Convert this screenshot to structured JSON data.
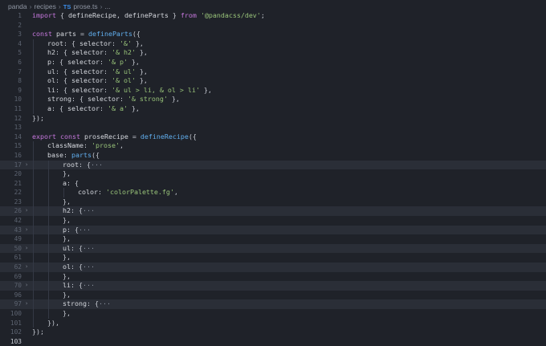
{
  "breadcrumb": {
    "items": [
      "panda",
      "recipes",
      "prose.ts",
      "..."
    ],
    "file_icon": "TS"
  },
  "lines": [
    {
      "n": "1",
      "fold": false,
      "indent": 0,
      "tokens": [
        [
          "k",
          "import"
        ],
        [
          "pl",
          " { "
        ],
        [
          "pr",
          "defineRecipe"
        ],
        [
          "pl",
          ", "
        ],
        [
          "pr",
          "defineParts"
        ],
        [
          "pl",
          " } "
        ],
        [
          "k",
          "from"
        ],
        [
          "pl",
          " "
        ],
        [
          "s",
          "'@pandacss/dev'"
        ],
        [
          "pl",
          ";"
        ]
      ]
    },
    {
      "n": "2",
      "fold": false,
      "indent": 0,
      "tokens": []
    },
    {
      "n": "3",
      "fold": false,
      "indent": 0,
      "tokens": [
        [
          "k",
          "const"
        ],
        [
          "pl",
          " "
        ],
        [
          "pr",
          "parts"
        ],
        [
          "pl",
          " = "
        ],
        [
          "f",
          "defineParts"
        ],
        [
          "pl",
          "({"
        ]
      ]
    },
    {
      "n": "4",
      "fold": false,
      "indent": 1,
      "tokens": [
        [
          "pr",
          "root"
        ],
        [
          "pl",
          ": { "
        ],
        [
          "pr",
          "selector"
        ],
        [
          "pl",
          ": "
        ],
        [
          "s",
          "'&'"
        ],
        [
          "pl",
          " },"
        ]
      ]
    },
    {
      "n": "5",
      "fold": false,
      "indent": 1,
      "tokens": [
        [
          "pr",
          "h2"
        ],
        [
          "pl",
          ": { "
        ],
        [
          "pr",
          "selector"
        ],
        [
          "pl",
          ": "
        ],
        [
          "s",
          "'& h2'"
        ],
        [
          "pl",
          " },"
        ]
      ]
    },
    {
      "n": "6",
      "fold": false,
      "indent": 1,
      "tokens": [
        [
          "pr",
          "p"
        ],
        [
          "pl",
          ": { "
        ],
        [
          "pr",
          "selector"
        ],
        [
          "pl",
          ": "
        ],
        [
          "s",
          "'& p'"
        ],
        [
          "pl",
          " },"
        ]
      ]
    },
    {
      "n": "7",
      "fold": false,
      "indent": 1,
      "tokens": [
        [
          "pr",
          "ul"
        ],
        [
          "pl",
          ": { "
        ],
        [
          "pr",
          "selector"
        ],
        [
          "pl",
          ": "
        ],
        [
          "s",
          "'& ul'"
        ],
        [
          "pl",
          " },"
        ]
      ]
    },
    {
      "n": "8",
      "fold": false,
      "indent": 1,
      "tokens": [
        [
          "pr",
          "ol"
        ],
        [
          "pl",
          ": { "
        ],
        [
          "pr",
          "selector"
        ],
        [
          "pl",
          ": "
        ],
        [
          "s",
          "'& ol'"
        ],
        [
          "pl",
          " },"
        ]
      ]
    },
    {
      "n": "9",
      "fold": false,
      "indent": 1,
      "tokens": [
        [
          "pr",
          "li"
        ],
        [
          "pl",
          ": { "
        ],
        [
          "pr",
          "selector"
        ],
        [
          "pl",
          ": "
        ],
        [
          "s",
          "'& ul > li, & ol > li'"
        ],
        [
          "pl",
          " },"
        ]
      ]
    },
    {
      "n": "10",
      "fold": false,
      "indent": 1,
      "tokens": [
        [
          "pr",
          "strong"
        ],
        [
          "pl",
          ": { "
        ],
        [
          "pr",
          "selector"
        ],
        [
          "pl",
          ": "
        ],
        [
          "s",
          "'& strong'"
        ],
        [
          "pl",
          " },"
        ]
      ]
    },
    {
      "n": "11",
      "fold": false,
      "indent": 1,
      "tokens": [
        [
          "pr",
          "a"
        ],
        [
          "pl",
          ": { "
        ],
        [
          "pr",
          "selector"
        ],
        [
          "pl",
          ": "
        ],
        [
          "s",
          "'& a'"
        ],
        [
          "pl",
          " },"
        ]
      ]
    },
    {
      "n": "12",
      "fold": false,
      "indent": 0,
      "tokens": [
        [
          "pl",
          "});"
        ]
      ]
    },
    {
      "n": "13",
      "fold": false,
      "indent": 0,
      "tokens": []
    },
    {
      "n": "14",
      "fold": false,
      "indent": 0,
      "tokens": [
        [
          "k",
          "export"
        ],
        [
          "pl",
          " "
        ],
        [
          "k",
          "const"
        ],
        [
          "pl",
          " "
        ],
        [
          "pr",
          "proseRecipe"
        ],
        [
          "pl",
          " = "
        ],
        [
          "f",
          "defineRecipe"
        ],
        [
          "pl",
          "({"
        ]
      ]
    },
    {
      "n": "15",
      "fold": false,
      "indent": 1,
      "tokens": [
        [
          "pr",
          "className"
        ],
        [
          "pl",
          ": "
        ],
        [
          "s",
          "'prose'"
        ],
        [
          "pl",
          ","
        ]
      ]
    },
    {
      "n": "16",
      "fold": false,
      "indent": 1,
      "tokens": [
        [
          "pr",
          "base"
        ],
        [
          "pl",
          ": "
        ],
        [
          "f",
          "parts"
        ],
        [
          "pl",
          "({"
        ]
      ]
    },
    {
      "n": "17",
      "fold": true,
      "indent": 2,
      "tokens": [
        [
          "pr",
          "root"
        ],
        [
          "pl",
          ": {"
        ],
        [
          "el",
          "···"
        ]
      ]
    },
    {
      "n": "20",
      "fold": false,
      "indent": 2,
      "tokens": [
        [
          "pl",
          "},"
        ]
      ]
    },
    {
      "n": "21",
      "fold": false,
      "indent": 2,
      "tokens": [
        [
          "pr",
          "a"
        ],
        [
          "pl",
          ": {"
        ]
      ]
    },
    {
      "n": "22",
      "fold": false,
      "indent": 3,
      "tokens": [
        [
          "pr",
          "color"
        ],
        [
          "pl",
          ": "
        ],
        [
          "s",
          "'colorPalette.fg'"
        ],
        [
          "pl",
          ","
        ]
      ]
    },
    {
      "n": "23",
      "fold": false,
      "indent": 2,
      "tokens": [
        [
          "pl",
          "},"
        ]
      ]
    },
    {
      "n": "26",
      "fold": true,
      "indent": 2,
      "tokens": [
        [
          "pr",
          "h2"
        ],
        [
          "pl",
          ": {"
        ],
        [
          "el",
          "···"
        ]
      ]
    },
    {
      "n": "42",
      "fold": false,
      "indent": 2,
      "tokens": [
        [
          "pl",
          "},"
        ]
      ]
    },
    {
      "n": "43",
      "fold": true,
      "indent": 2,
      "tokens": [
        [
          "pr",
          "p"
        ],
        [
          "pl",
          ": {"
        ],
        [
          "el",
          "···"
        ]
      ]
    },
    {
      "n": "49",
      "fold": false,
      "indent": 2,
      "tokens": [
        [
          "pl",
          "},"
        ]
      ]
    },
    {
      "n": "50",
      "fold": true,
      "indent": 2,
      "tokens": [
        [
          "pr",
          "ul"
        ],
        [
          "pl",
          ": {"
        ],
        [
          "el",
          "···"
        ]
      ]
    },
    {
      "n": "61",
      "fold": false,
      "indent": 2,
      "tokens": [
        [
          "pl",
          "},"
        ]
      ]
    },
    {
      "n": "62",
      "fold": true,
      "indent": 2,
      "tokens": [
        [
          "pr",
          "ol"
        ],
        [
          "pl",
          ": {"
        ],
        [
          "el",
          "···"
        ]
      ]
    },
    {
      "n": "69",
      "fold": false,
      "indent": 2,
      "tokens": [
        [
          "pl",
          "},"
        ]
      ]
    },
    {
      "n": "70",
      "fold": true,
      "indent": 2,
      "tokens": [
        [
          "pr",
          "li"
        ],
        [
          "pl",
          ": {"
        ],
        [
          "el",
          "···"
        ]
      ]
    },
    {
      "n": "96",
      "fold": false,
      "indent": 2,
      "tokens": [
        [
          "pl",
          "},"
        ]
      ]
    },
    {
      "n": "97",
      "fold": true,
      "indent": 2,
      "tokens": [
        [
          "pr",
          "strong"
        ],
        [
          "pl",
          ": {"
        ],
        [
          "el",
          "···"
        ]
      ]
    },
    {
      "n": "100",
      "fold": false,
      "indent": 2,
      "tokens": [
        [
          "pl",
          "},"
        ]
      ]
    },
    {
      "n": "101",
      "fold": false,
      "indent": 1,
      "tokens": [
        [
          "pl",
          "}),"
        ]
      ]
    },
    {
      "n": "102",
      "fold": false,
      "indent": 0,
      "tokens": [
        [
          "pl",
          "});"
        ]
      ]
    },
    {
      "n": "103",
      "fold": false,
      "indent": 0,
      "tokens": [],
      "current": true
    }
  ],
  "colors": {
    "background": "#1f2229",
    "keyword": "#c678dd",
    "function": "#61afef",
    "string": "#98c379",
    "folded_bg": "#2a2e37"
  }
}
